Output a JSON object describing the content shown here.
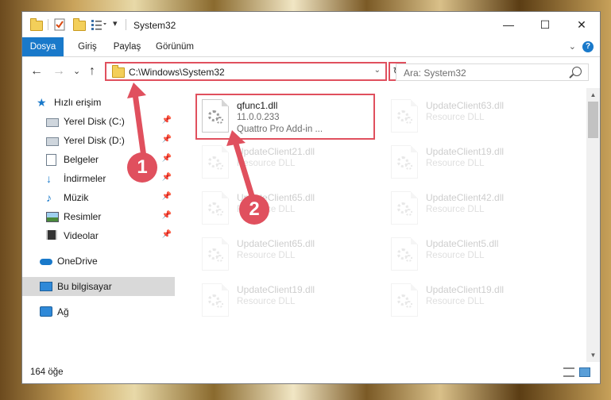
{
  "window": {
    "title": "System32",
    "controls": {
      "minimize": "—",
      "maximize": "☐",
      "close": "✕"
    }
  },
  "ribbon": {
    "tabs": [
      "Dosya",
      "Giriş",
      "Paylaş",
      "Görünüm"
    ],
    "help": "?",
    "expand": "⌄"
  },
  "navigation": {
    "back": "←",
    "forward": "→",
    "recent": "⌄",
    "up": "↑",
    "address": "C:\\Windows\\System32",
    "refresh": "↻",
    "search_placeholder": "Ara: System32"
  },
  "sidebar": {
    "items": [
      {
        "label": "Hızlı erişim",
        "icon": "star-icon"
      },
      {
        "label": "Yerel Disk (C:)",
        "icon": "disk-icon",
        "pinned": true
      },
      {
        "label": "Yerel Disk (D:)",
        "icon": "disk-icon",
        "pinned": true
      },
      {
        "label": "Belgeler",
        "icon": "document-icon",
        "pinned": true
      },
      {
        "label": "İndirmeler",
        "icon": "download-icon",
        "pinned": true
      },
      {
        "label": "Müzik",
        "icon": "music-icon",
        "pinned": true
      },
      {
        "label": "Resimler",
        "icon": "picture-icon",
        "pinned": true
      },
      {
        "label": "Videolar",
        "icon": "video-icon",
        "pinned": true
      },
      {
        "label": "OneDrive",
        "icon": "cloud-icon"
      },
      {
        "label": "Bu bilgisayar",
        "icon": "computer-icon",
        "selected": true
      },
      {
        "label": "Ağ",
        "icon": "network-icon"
      }
    ]
  },
  "files": [
    {
      "name": "qfunc1.dll",
      "version": "11.0.0.233",
      "description": "Quattro Pro Add-in ...",
      "highlighted": true
    },
    {
      "name": "UpdateClient63.dll",
      "description": "Resource DLL"
    },
    {
      "name": "UpdateClient21.dll",
      "description": "Resource DLL"
    },
    {
      "name": "UpdateClient19.dll",
      "description": "Resource DLL"
    },
    {
      "name": "UpdateClient65.dll",
      "description": "Resource DLL"
    },
    {
      "name": "UpdateClient42.dll",
      "description": "Resource DLL"
    },
    {
      "name": "UpdateClient65.dll",
      "description": "Resource DLL"
    },
    {
      "name": "UpdateClient5.dll",
      "description": "Resource DLL"
    },
    {
      "name": "UpdateClient19.dll",
      "description": "Resource DLL"
    },
    {
      "name": "UpdateClient19.dll",
      "description": "Resource DLL"
    }
  ],
  "status": {
    "item_count": "164 öğe"
  },
  "annotations": {
    "step1": "1",
    "step2": "2",
    "color": "#e0505e"
  }
}
